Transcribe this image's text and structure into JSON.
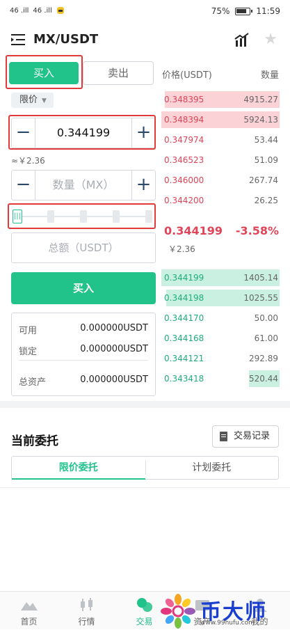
{
  "status_bar": {
    "signal_left": "46 .ill",
    "signal_right": "46 .ill",
    "battery": "75%",
    "time": "11:59"
  },
  "header": {
    "title": "MX/USDT"
  },
  "trade": {
    "tab_buy": "买入",
    "tab_sell": "卖出",
    "order_type": "限价",
    "price_value": "0.344199",
    "approx_cny": "≈￥2.36",
    "amount_placeholder": "数量（MX）",
    "total_placeholder": "总额（USDT）",
    "buy_button": "买入",
    "balance": [
      {
        "label": "可用",
        "value": "0.000000USDT"
      },
      {
        "label": "锁定",
        "value": "0.000000USDT"
      },
      {
        "label": "总资产",
        "value": "0.000000USDT"
      }
    ]
  },
  "orderbook": {
    "price_header": "价格(USDT)",
    "qty_header": "数量",
    "asks": [
      {
        "price": "0.348395",
        "qty": "4915.27",
        "depth": 0.97
      },
      {
        "price": "0.348394",
        "qty": "5924.13",
        "depth": 1.0
      },
      {
        "price": "0.347974",
        "qty": "53.44",
        "depth": 0
      },
      {
        "price": "0.346523",
        "qty": "51.09",
        "depth": 0
      },
      {
        "price": "0.346000",
        "qty": "267.74",
        "depth": 0
      },
      {
        "price": "0.344200",
        "qty": "26.25",
        "depth": 0
      }
    ],
    "last_price": "0.344199",
    "change": "-3.58%",
    "last_cny": "￥2.36",
    "bids": [
      {
        "price": "0.344199",
        "qty": "1405.14",
        "depth": 1.0
      },
      {
        "price": "0.344198",
        "qty": "1025.55",
        "depth": 0.96
      },
      {
        "price": "0.344170",
        "qty": "50.00",
        "depth": 0
      },
      {
        "price": "0.344168",
        "qty": "61.00",
        "depth": 0
      },
      {
        "price": "0.344121",
        "qty": "292.89",
        "depth": 0
      },
      {
        "price": "0.343418",
        "qty": "520.44",
        "depth": 0.26
      }
    ]
  },
  "orders": {
    "title": "当前委托",
    "record_button": "交易记录",
    "tab_limit": "限价委托",
    "tab_plan": "计划委托"
  },
  "bottom_nav": [
    {
      "label": "首页",
      "icon": "mountain-icon"
    },
    {
      "label": "行情",
      "icon": "candlestick-icon"
    },
    {
      "label": "交易",
      "icon": "trade-icon",
      "active": true
    },
    {
      "label": "资产",
      "icon": "wallet-icon"
    },
    {
      "label": "我的",
      "icon": "profile-icon"
    }
  ],
  "watermark": {
    "brand": "币大师",
    "url": "www.99hufu.com"
  },
  "colors": {
    "green": "#22c28b",
    "red": "#e04458",
    "highlight": "#e23a3a"
  }
}
